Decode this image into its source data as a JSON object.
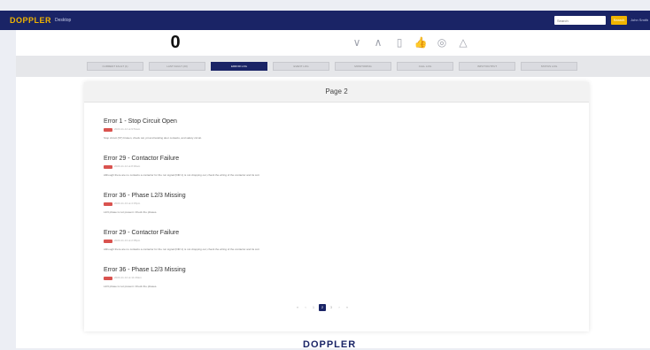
{
  "header": {
    "logo": "DOPPLER",
    "subtitle": "Desktop",
    "search_placeholder": "Search",
    "search_button": "Search",
    "user_link": "John Smith"
  },
  "counter": {
    "value": "0"
  },
  "toolbar": {
    "icons": [
      "chevron-down-icon",
      "chevron-up-icon",
      "document-icon",
      "thumbs-up-icon",
      "clock-icon",
      "bell-icon"
    ],
    "glyphs": [
      "∨",
      "∧",
      "▯",
      "👍",
      "◎",
      "△"
    ]
  },
  "tabs": [
    {
      "label": "CURRENT FAULT (1)",
      "active": false
    },
    {
      "label": "LAST FAULT (20)",
      "active": false
    },
    {
      "label": "ERROR LOG",
      "active": true
    },
    {
      "label": "EVENT LOG",
      "active": false
    },
    {
      "label": "MONITORING",
      "active": false
    },
    {
      "label": "CALL LOG",
      "active": false
    },
    {
      "label": "INPUT/OUTPUT",
      "active": false
    },
    {
      "label": "STATUS LOG",
      "active": false
    }
  ],
  "card": {
    "title": "Page 2",
    "errors": [
      {
        "title": "Error 1 - Stop Circuit Open",
        "date": "2023-11-14 at 9:51am",
        "desc": "Stop circuit (ST) broken, check car, pit and landing door contacts, and safety circuit."
      },
      {
        "title": "Error 29 - Contactor Failure",
        "date": "2023-11-14 at 8:30am",
        "desc": "Although there are no contacts a contactor for the run signal (DIR 1) is not dropping out; check the wiring of the contactor and its coil."
      },
      {
        "title": "Error 36 - Phase L2/3 Missing",
        "date": "2023-11-13 at 4:15pm",
        "desc": "L2/3 phase is not present. Check the phases."
      },
      {
        "title": "Error 29 - Contactor Failure",
        "date": "2023-11-13 at 2:05pm",
        "desc": "Although there are no contacts a contactor for the run signal (DIR 1) is not dropping out; check the wiring of the contactor and its coil."
      },
      {
        "title": "Error 36 - Phase L2/3 Missing",
        "date": "2023-11-12 at 11:20am",
        "desc": "L2/3 phase is not present. Check the phases."
      }
    ]
  },
  "pagination": {
    "items": [
      "«",
      "‹",
      "1",
      "2",
      "3",
      "›",
      "»"
    ],
    "active_index": 3
  },
  "footer": {
    "logo": "DOPPLER"
  },
  "colors": {
    "brand_navy": "#1a2466",
    "brand_gold": "#f0b400",
    "error_red": "#d9534f"
  }
}
